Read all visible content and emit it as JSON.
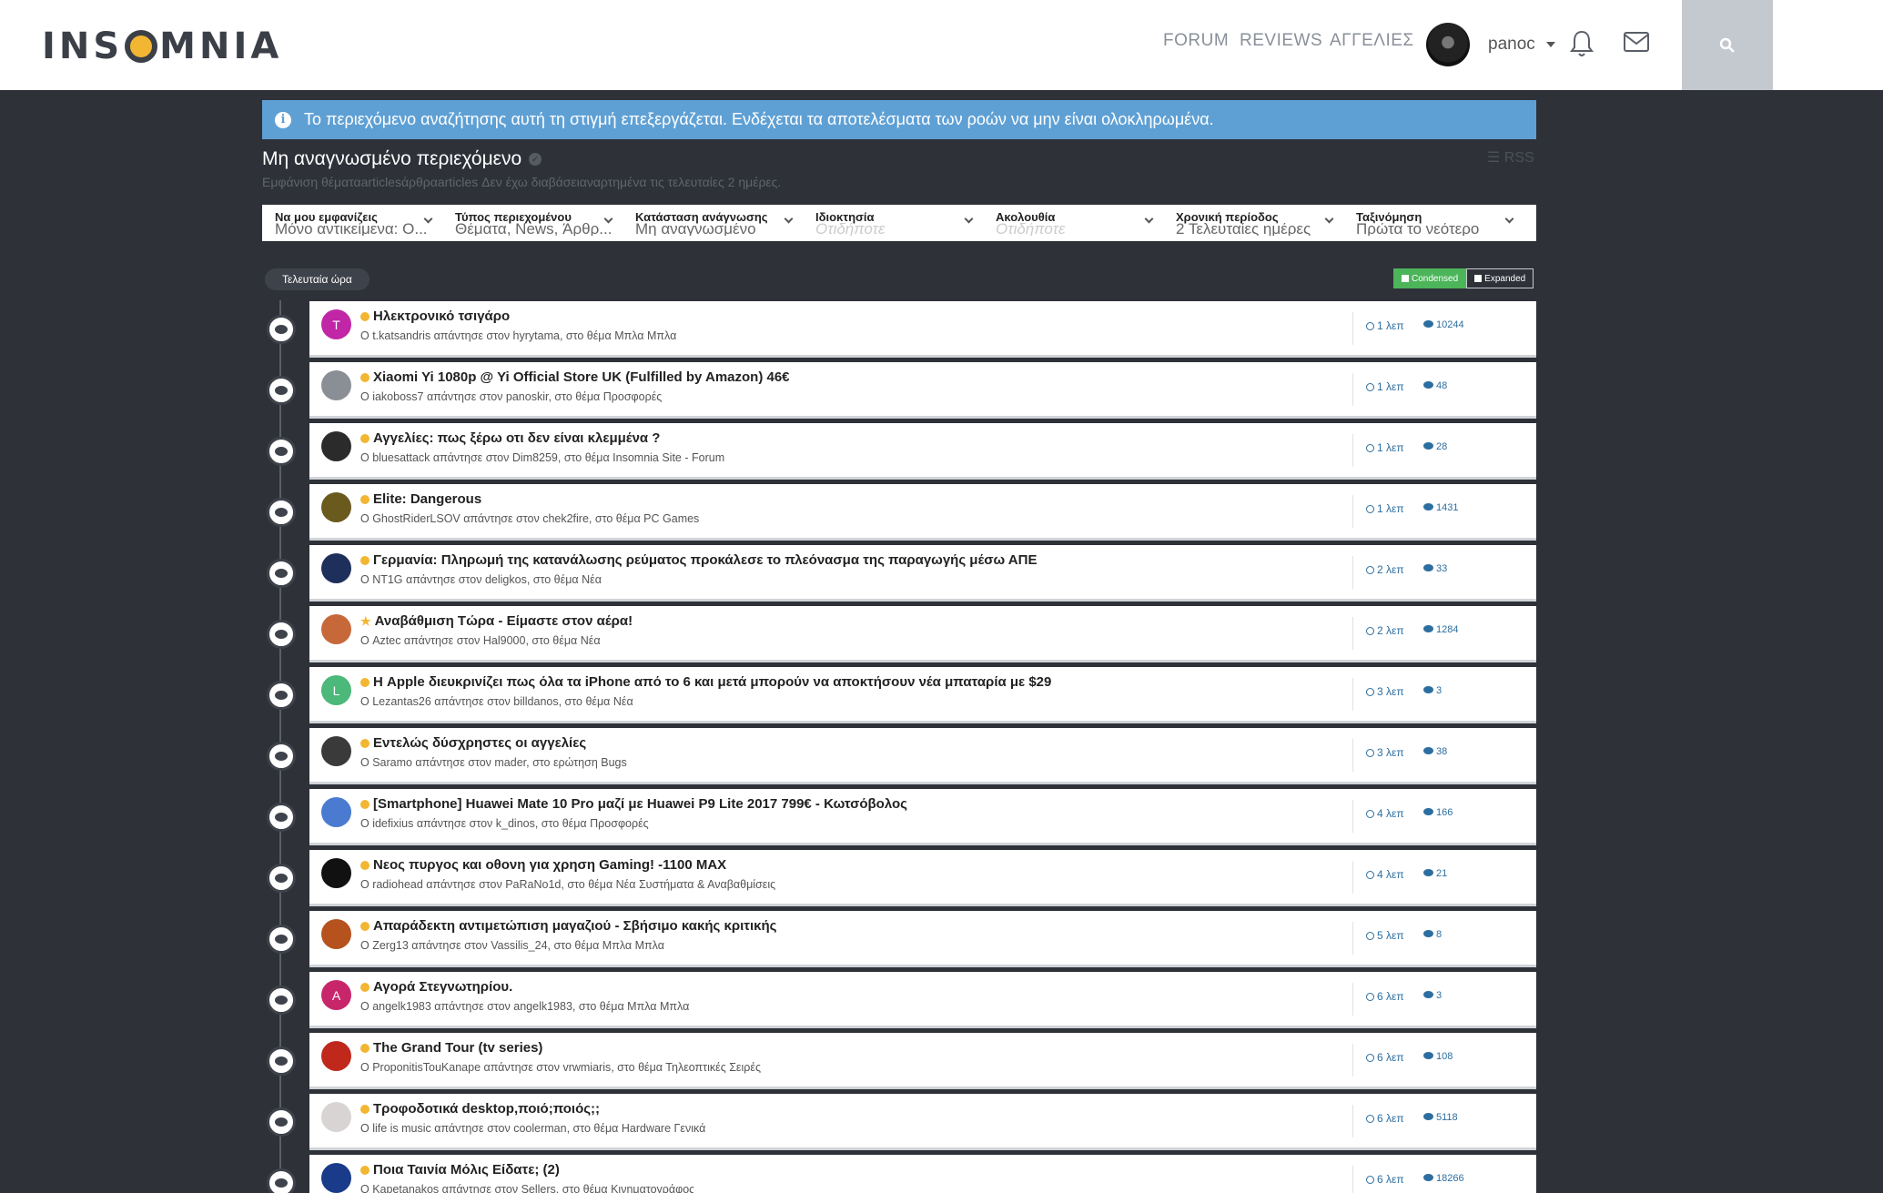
{
  "header": {
    "logo_text_left": "INS",
    "logo_text_right": "MNIA",
    "nav": [
      "FORUM",
      "REVIEWS",
      "ΑΓΓΕΛΙΕΣ"
    ],
    "username": "panoc",
    "icons": [
      "bell-icon",
      "mail-icon",
      "search-icon"
    ]
  },
  "alert": {
    "text": "Το περιεχόμενο αναζήτησης αυτή τη στιγμή επεξεργάζεται. Ενδέχεται τα αποτελέσματα των ροών να μην είναι ολοκληρωμένα."
  },
  "page": {
    "title": "Μη αναγνωσμένο περιεχόμενο",
    "rss": "RSS",
    "subtitle": "Εμφάνιση θέματαarticlesάρθραarticles Δεν έχω διαβάσειαναρτημένα τις τελευταίες 2 ημέρες."
  },
  "filters": [
    {
      "label": "Να μου εμφανίζεις",
      "value": "Μόνο αντικείμενα: Ο..."
    },
    {
      "label": "Τύπος περιεχομένου",
      "value": "Θέματα, News, Άρθρ..."
    },
    {
      "label": "Κατάσταση ανάγνωσης",
      "value": "Μη αναγνωσμένο"
    },
    {
      "label": "Ιδιοκτησία",
      "value": "Οτιδήποτε"
    },
    {
      "label": "Ακολουθία",
      "value": "Οτιδήποτε"
    },
    {
      "label": "Χρονική περίοδος",
      "value": "2 Τελευταίες ημέρες"
    },
    {
      "label": "Ταξινόμηση",
      "value": "Πρώτα το νεότερο"
    }
  ],
  "time_group": "Τελευταία ώρα",
  "view_toggle": {
    "condensed": "Condensed",
    "expanded": "Expanded"
  },
  "items": [
    {
      "title": "Ηλεκτρονικό τσιγάρο",
      "sub": "Ο t.katsandris απάντησε στον hyrytama, στο θέμα Μπλα Μπλα",
      "time": "1 λεπ",
      "count": "10244",
      "avatar": "T",
      "avatar_color": "#c026a6",
      "marker": "dot"
    },
    {
      "title": "Xiaomi Yi 1080p @ Yi Official Store UK (Fulfilled by Amazon) 46€",
      "sub": "Ο iakoboss7 απάντησε στον panoskir, στο θέμα Προσφορές",
      "time": "1 λεπ",
      "count": "48",
      "avatar": "",
      "avatar_color": "#8a8f96",
      "marker": "dot"
    },
    {
      "title": "Αγγελίες: πως ξέρω οτι δεν είναι κλεμμένα ?",
      "sub": "Ο bluesattack απάντησε στον Dim8259, στο θέμα Insomnia Site - Forum",
      "time": "1 λεπ",
      "count": "28",
      "avatar": "",
      "avatar_color": "#2b2b2b",
      "marker": "dot"
    },
    {
      "title": "Elite: Dangerous",
      "sub": "Ο GhostRiderLSOV απάντησε στον chek2fire, στο θέμα PC Games",
      "time": "1 λεπ",
      "count": "1431",
      "avatar": "",
      "avatar_color": "#6b5a1e",
      "marker": "dot"
    },
    {
      "title": "Γερμανία: Πληρωμή της κατανάλωσης ρεύματος προκάλεσε το πλεόνασμα της παραγωγής μέσω ΑΠΕ",
      "sub": "Ο NT1G απάντησε στον deligkos, στο θέμα Νέα",
      "time": "2 λεπ",
      "count": "33",
      "avatar": "",
      "avatar_color": "#1e2f5c",
      "marker": "dot"
    },
    {
      "title": "Αναβάθμιση Τώρα - Είμαστε στον αέρα!",
      "sub": "Ο Aztec απάντησε στον Hal9000, στο θέμα Νέα",
      "time": "2 λεπ",
      "count": "1284",
      "avatar": "",
      "avatar_color": "#c7683a",
      "marker": "star"
    },
    {
      "title": "Η Apple διευκρινίζει πως όλα τα iPhone από το 6 και μετά μπορούν να αποκτήσουν νέα μπαταρία με $29",
      "sub": "Ο Lezantas26 απάντησε στον billdanos, στο θέμα Νέα",
      "time": "3 λεπ",
      "count": "3",
      "avatar": "L",
      "avatar_color": "#4cb87a",
      "marker": "dot"
    },
    {
      "title": "Εντελώς δύσχρηστες οι αγγελίες",
      "sub": "Ο Saramo απάντησε στον mader, στο ερώτηση Bugs",
      "time": "3 λεπ",
      "count": "38",
      "avatar": "",
      "avatar_color": "#3a3a3a",
      "marker": "dot"
    },
    {
      "title": "[Smartphone] Huawei Mate 10 Pro μαζί με Huawei P9 Lite 2017 799€ - Κωτσόβολος",
      "sub": "Ο idefixius απάντησε στον k_dinos, στο θέμα Προσφορές",
      "time": "4 λεπ",
      "count": "166",
      "avatar": "",
      "avatar_color": "#4a7bd0",
      "marker": "dot"
    },
    {
      "title": "Νεος πυργος και οθονη για χρηση Gaming! -1100 MAX",
      "sub": "Ο radiohead απάντησε στον PaRaNo1d, στο θέμα Νέα Συστήματα & Αναβαθμίσεις",
      "time": "4 λεπ",
      "count": "21",
      "avatar": "",
      "avatar_color": "#111111",
      "marker": "dot"
    },
    {
      "title": "Απαράδεκτη αντιμετώπιση μαγαζιού - Σβήσιμο κακής κριτικής",
      "sub": "Ο Zerg13 απάντησε στον Vassilis_24, στο θέμα Μπλα Μπλα",
      "time": "5 λεπ",
      "count": "8",
      "avatar": "",
      "avatar_color": "#b5521d",
      "marker": "dot"
    },
    {
      "title": "Αγορά Στεγνωτηρίου.",
      "sub": "Ο angelk1983 απάντησε στον angelk1983, στο θέμα Μπλα Μπλα",
      "time": "6 λεπ",
      "count": "3",
      "avatar": "A",
      "avatar_color": "#c8266b",
      "marker": "dot"
    },
    {
      "title": "The Grand Tour (tv series)",
      "sub": "Ο ProponitisTouKanape απάντησε στον vrwmiaris, στο θέμα Τηλεοπτικές Σειρές",
      "time": "6 λεπ",
      "count": "108",
      "avatar": "",
      "avatar_color": "#c0281c",
      "marker": "dot"
    },
    {
      "title": "Τροφοδοτικά desktop,ποιό;ποιός;;",
      "sub": "Ο life is music απάντησε στον coolerman, στο θέμα Hardware Γενικά",
      "time": "6 λεπ",
      "count": "5118",
      "avatar": "",
      "avatar_color": "#d9d4d4",
      "marker": "dot"
    },
    {
      "title": "Ποια Ταινία Μόλις Είδατε; (2)",
      "sub": "Ο Kapetanakos απάντησε στον Sellers, στο θέμα Κινηματογράφος",
      "time": "6 λεπ",
      "count": "18266",
      "avatar": "",
      "avatar_color": "#1a3a8a",
      "marker": "dot"
    }
  ]
}
